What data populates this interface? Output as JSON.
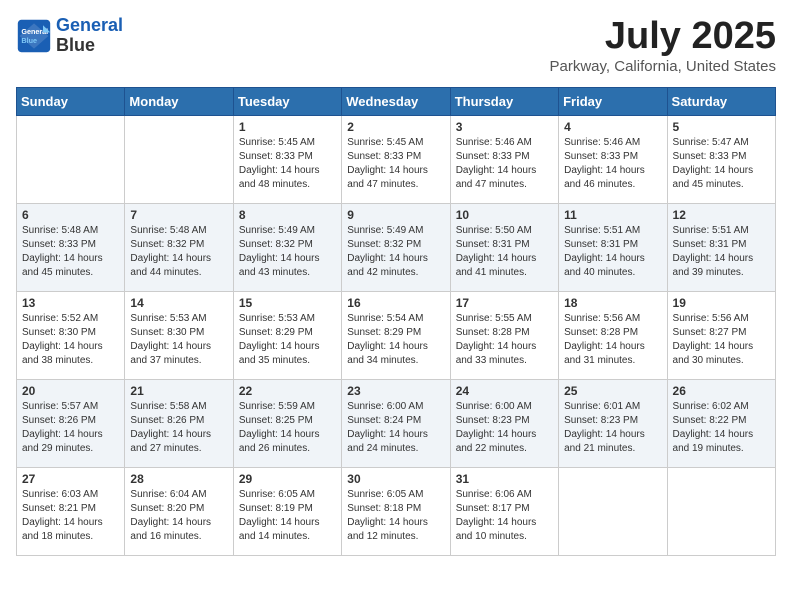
{
  "header": {
    "logo_line1": "General",
    "logo_line2": "Blue",
    "title": "July 2025",
    "subtitle": "Parkway, California, United States"
  },
  "weekdays": [
    "Sunday",
    "Monday",
    "Tuesday",
    "Wednesday",
    "Thursday",
    "Friday",
    "Saturday"
  ],
  "weeks": [
    [
      {
        "day": "",
        "info": ""
      },
      {
        "day": "",
        "info": ""
      },
      {
        "day": "1",
        "info": "Sunrise: 5:45 AM\nSunset: 8:33 PM\nDaylight: 14 hours and 48 minutes."
      },
      {
        "day": "2",
        "info": "Sunrise: 5:45 AM\nSunset: 8:33 PM\nDaylight: 14 hours and 47 minutes."
      },
      {
        "day": "3",
        "info": "Sunrise: 5:46 AM\nSunset: 8:33 PM\nDaylight: 14 hours and 47 minutes."
      },
      {
        "day": "4",
        "info": "Sunrise: 5:46 AM\nSunset: 8:33 PM\nDaylight: 14 hours and 46 minutes."
      },
      {
        "day": "5",
        "info": "Sunrise: 5:47 AM\nSunset: 8:33 PM\nDaylight: 14 hours and 45 minutes."
      }
    ],
    [
      {
        "day": "6",
        "info": "Sunrise: 5:48 AM\nSunset: 8:33 PM\nDaylight: 14 hours and 45 minutes."
      },
      {
        "day": "7",
        "info": "Sunrise: 5:48 AM\nSunset: 8:32 PM\nDaylight: 14 hours and 44 minutes."
      },
      {
        "day": "8",
        "info": "Sunrise: 5:49 AM\nSunset: 8:32 PM\nDaylight: 14 hours and 43 minutes."
      },
      {
        "day": "9",
        "info": "Sunrise: 5:49 AM\nSunset: 8:32 PM\nDaylight: 14 hours and 42 minutes."
      },
      {
        "day": "10",
        "info": "Sunrise: 5:50 AM\nSunset: 8:31 PM\nDaylight: 14 hours and 41 minutes."
      },
      {
        "day": "11",
        "info": "Sunrise: 5:51 AM\nSunset: 8:31 PM\nDaylight: 14 hours and 40 minutes."
      },
      {
        "day": "12",
        "info": "Sunrise: 5:51 AM\nSunset: 8:31 PM\nDaylight: 14 hours and 39 minutes."
      }
    ],
    [
      {
        "day": "13",
        "info": "Sunrise: 5:52 AM\nSunset: 8:30 PM\nDaylight: 14 hours and 38 minutes."
      },
      {
        "day": "14",
        "info": "Sunrise: 5:53 AM\nSunset: 8:30 PM\nDaylight: 14 hours and 37 minutes."
      },
      {
        "day": "15",
        "info": "Sunrise: 5:53 AM\nSunset: 8:29 PM\nDaylight: 14 hours and 35 minutes."
      },
      {
        "day": "16",
        "info": "Sunrise: 5:54 AM\nSunset: 8:29 PM\nDaylight: 14 hours and 34 minutes."
      },
      {
        "day": "17",
        "info": "Sunrise: 5:55 AM\nSunset: 8:28 PM\nDaylight: 14 hours and 33 minutes."
      },
      {
        "day": "18",
        "info": "Sunrise: 5:56 AM\nSunset: 8:28 PM\nDaylight: 14 hours and 31 minutes."
      },
      {
        "day": "19",
        "info": "Sunrise: 5:56 AM\nSunset: 8:27 PM\nDaylight: 14 hours and 30 minutes."
      }
    ],
    [
      {
        "day": "20",
        "info": "Sunrise: 5:57 AM\nSunset: 8:26 PM\nDaylight: 14 hours and 29 minutes."
      },
      {
        "day": "21",
        "info": "Sunrise: 5:58 AM\nSunset: 8:26 PM\nDaylight: 14 hours and 27 minutes."
      },
      {
        "day": "22",
        "info": "Sunrise: 5:59 AM\nSunset: 8:25 PM\nDaylight: 14 hours and 26 minutes."
      },
      {
        "day": "23",
        "info": "Sunrise: 6:00 AM\nSunset: 8:24 PM\nDaylight: 14 hours and 24 minutes."
      },
      {
        "day": "24",
        "info": "Sunrise: 6:00 AM\nSunset: 8:23 PM\nDaylight: 14 hours and 22 minutes."
      },
      {
        "day": "25",
        "info": "Sunrise: 6:01 AM\nSunset: 8:23 PM\nDaylight: 14 hours and 21 minutes."
      },
      {
        "day": "26",
        "info": "Sunrise: 6:02 AM\nSunset: 8:22 PM\nDaylight: 14 hours and 19 minutes."
      }
    ],
    [
      {
        "day": "27",
        "info": "Sunrise: 6:03 AM\nSunset: 8:21 PM\nDaylight: 14 hours and 18 minutes."
      },
      {
        "day": "28",
        "info": "Sunrise: 6:04 AM\nSunset: 8:20 PM\nDaylight: 14 hours and 16 minutes."
      },
      {
        "day": "29",
        "info": "Sunrise: 6:05 AM\nSunset: 8:19 PM\nDaylight: 14 hours and 14 minutes."
      },
      {
        "day": "30",
        "info": "Sunrise: 6:05 AM\nSunset: 8:18 PM\nDaylight: 14 hours and 12 minutes."
      },
      {
        "day": "31",
        "info": "Sunrise: 6:06 AM\nSunset: 8:17 PM\nDaylight: 14 hours and 10 minutes."
      },
      {
        "day": "",
        "info": ""
      },
      {
        "day": "",
        "info": ""
      }
    ]
  ]
}
